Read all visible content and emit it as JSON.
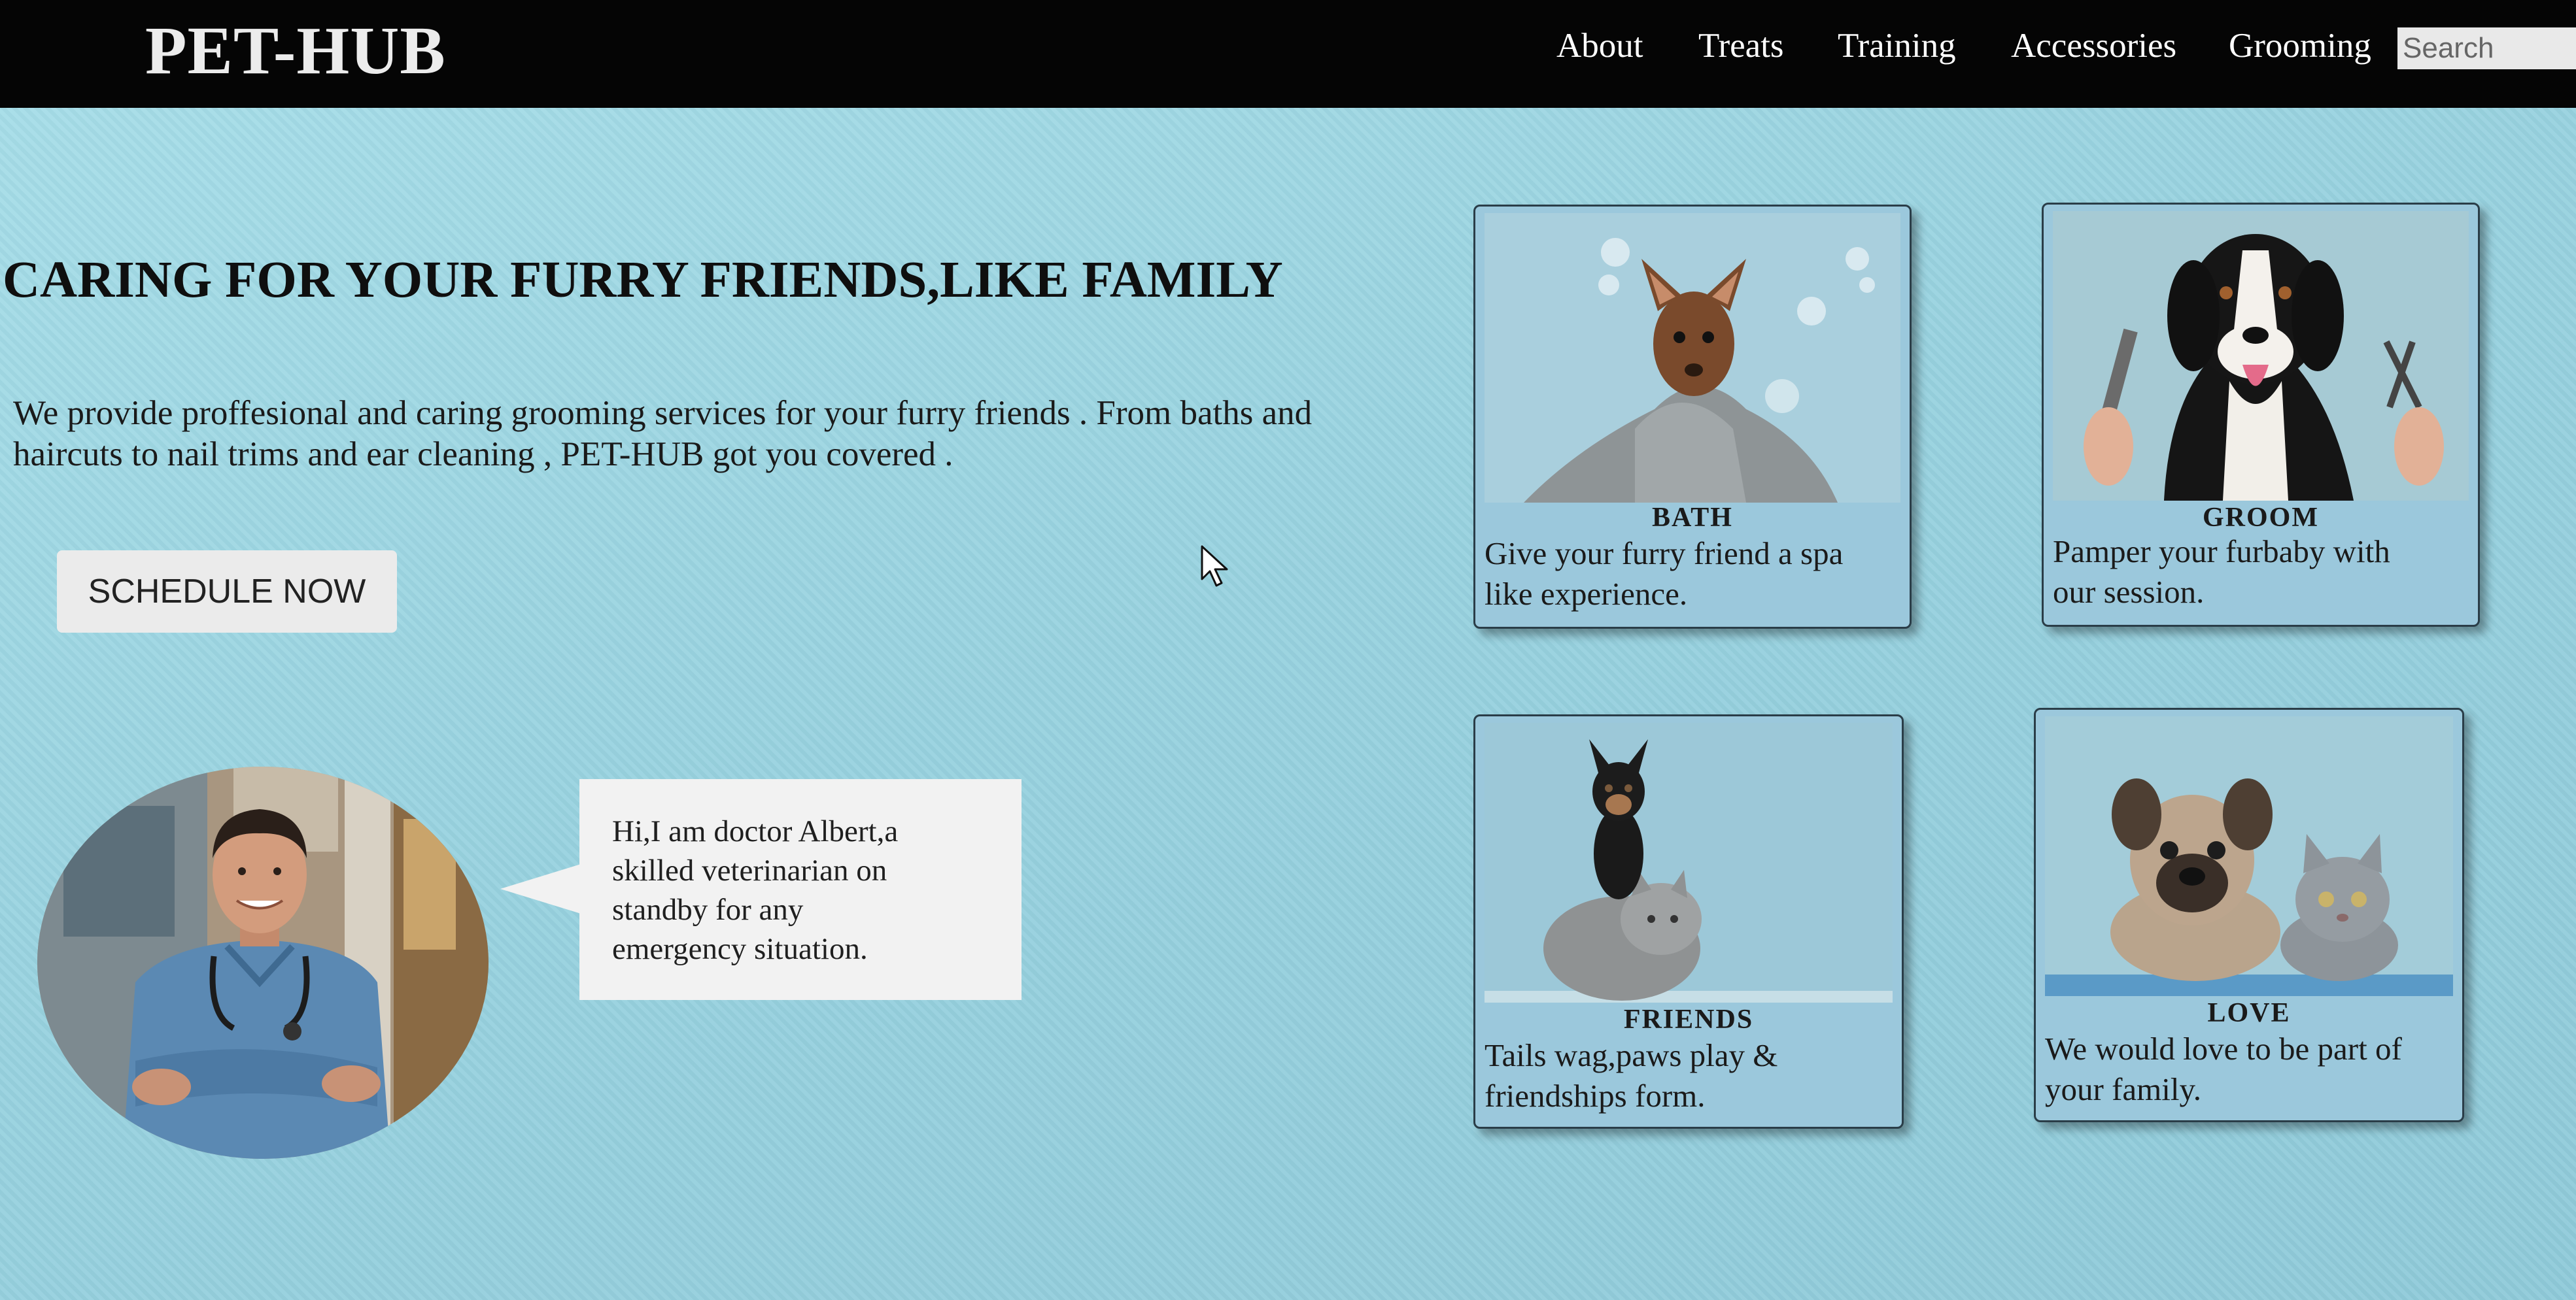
{
  "brand": {
    "logo": "PET-HUB"
  },
  "nav": {
    "links": [
      "About",
      "Treats",
      "Training",
      "Accessories",
      "Grooming"
    ],
    "search_placeholder": "Search"
  },
  "hero": {
    "headline": "CARING FOR YOUR FURRY FRIENDS,LIKE FAMILY",
    "intro_line1": "We provide proffesional and caring grooming services for your furry friends . From baths and",
    "intro_line2": "haircuts to nail trims and ear cleaning , PET-HUB got you covered .",
    "cta_label": "SCHEDULE NOW"
  },
  "vet": {
    "line1": "Hi,I am doctor Albert,a",
    "line2": "skilled veterinarian on",
    "line3": "standby for any",
    "line4": "emergency situation."
  },
  "cards": [
    {
      "title": "BATH",
      "line1": "Give your furry friend a spa",
      "line2": "like experience.",
      "image": "chihuahua-in-towel-photo"
    },
    {
      "title": "GROOM",
      "line1": "Pamper your furbaby with",
      "line2": "our session.",
      "image": "dog-with-comb-and-scissors-photo"
    },
    {
      "title": "FRIENDS",
      "line1": "Tails wag,paws play &",
      "line2": "friendships form.",
      "image": "dog-on-cat-photo"
    },
    {
      "title": "LOVE",
      "line1": "We would love to be part of",
      "line2": "your family.",
      "image": "puppy-and-kitten-photo"
    }
  ],
  "colors": {
    "navbar": "#050505",
    "background": "#9fd3df",
    "card": "#9bc8dc",
    "button": "#ebebeb"
  }
}
